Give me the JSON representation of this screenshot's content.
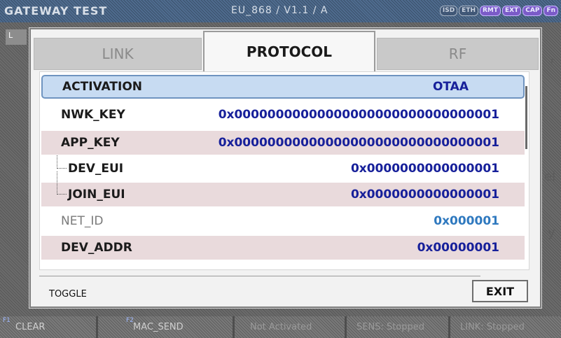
{
  "topbar": {
    "title": "GATEWAY TEST",
    "mode": "EU_868 / V1.1 / A",
    "flags": [
      "ISD",
      "ETH",
      "RMT",
      "EXT",
      "CAP",
      "Fn"
    ]
  },
  "background": {
    "left_marker": "L",
    "right_r": "r",
    "right_el": "el",
    "right_y": "y"
  },
  "tabs": [
    {
      "label": "LINK"
    },
    {
      "label": "PROTOCOL"
    },
    {
      "label": "RF"
    }
  ],
  "rows": [
    {
      "label": "ACTIVATION",
      "value": "OTAA"
    },
    {
      "label": "NWK_KEY",
      "value": "0x00000000000000000000000000000001"
    },
    {
      "label": "APP_KEY",
      "value": "0x00000000000000000000000000000001"
    },
    {
      "label": "DEV_EUI",
      "value": "0x0000000000000001"
    },
    {
      "label": "JOIN_EUI",
      "value": "0x0000000000000001"
    },
    {
      "label": "NET_ID",
      "value": "0x000001"
    },
    {
      "label": "DEV_ADDR",
      "value": "0x00000001"
    }
  ],
  "footer": {
    "toggle": "TOGGLE",
    "exit": "EXIT"
  },
  "softkeys": [
    {
      "fn": "F1",
      "label": "CLEAR"
    },
    {
      "fn": "F2",
      "label": "MAC_SEND"
    },
    {
      "fn": "",
      "label": "Not Activated"
    },
    {
      "fn": "",
      "label": "SENS: Stopped"
    },
    {
      "fn": "",
      "label": "LINK: Stopped"
    }
  ]
}
